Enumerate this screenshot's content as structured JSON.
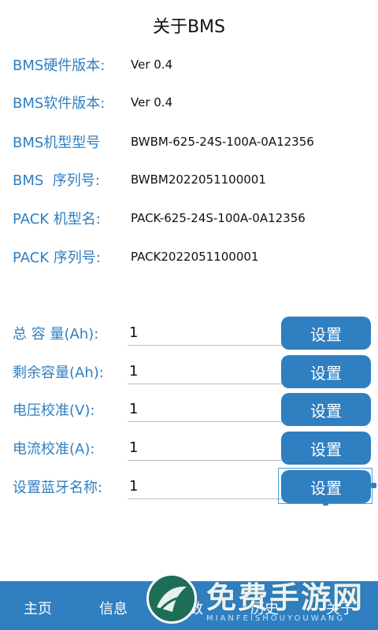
{
  "header": {
    "title": "关于BMS"
  },
  "info": [
    {
      "label": "BMS硬件版本:",
      "value": "Ver 0.4"
    },
    {
      "label": "BMS软件版本:",
      "value": "Ver 0.4"
    },
    {
      "label": "BMS机型型号",
      "value": "BWBM-625-24S-100A-0A12356"
    },
    {
      "label": "BMS  序列号:",
      "value": "BWBM2022051100001"
    },
    {
      "label": "PACK 机型名:",
      "value": "PACK-625-24S-100A-0A12356"
    },
    {
      "label": "PACK 序列号:",
      "value": "PACK2022051100001"
    }
  ],
  "settings": [
    {
      "label": "总 容 量(Ah):",
      "value": "1",
      "button": "设置"
    },
    {
      "label": "剩余容量(Ah):",
      "value": "1",
      "button": "设置"
    },
    {
      "label": "电压校准(V):",
      "value": "1",
      "button": "设置"
    },
    {
      "label": "电流校准(A):",
      "value": "1",
      "button": "设置"
    },
    {
      "label": "设置蓝牙名称:",
      "value": "1",
      "button": "设置"
    }
  ],
  "nav": [
    {
      "label": "主页"
    },
    {
      "label": "信息"
    },
    {
      "label": "参数"
    },
    {
      "label": "历史"
    },
    {
      "label": "关于"
    }
  ],
  "watermark": {
    "main": "免费手游网",
    "sub": "MIANFEISHOUYOUWANG"
  },
  "colors": {
    "accent": "#2f7fc1",
    "background": "#ffffff"
  }
}
